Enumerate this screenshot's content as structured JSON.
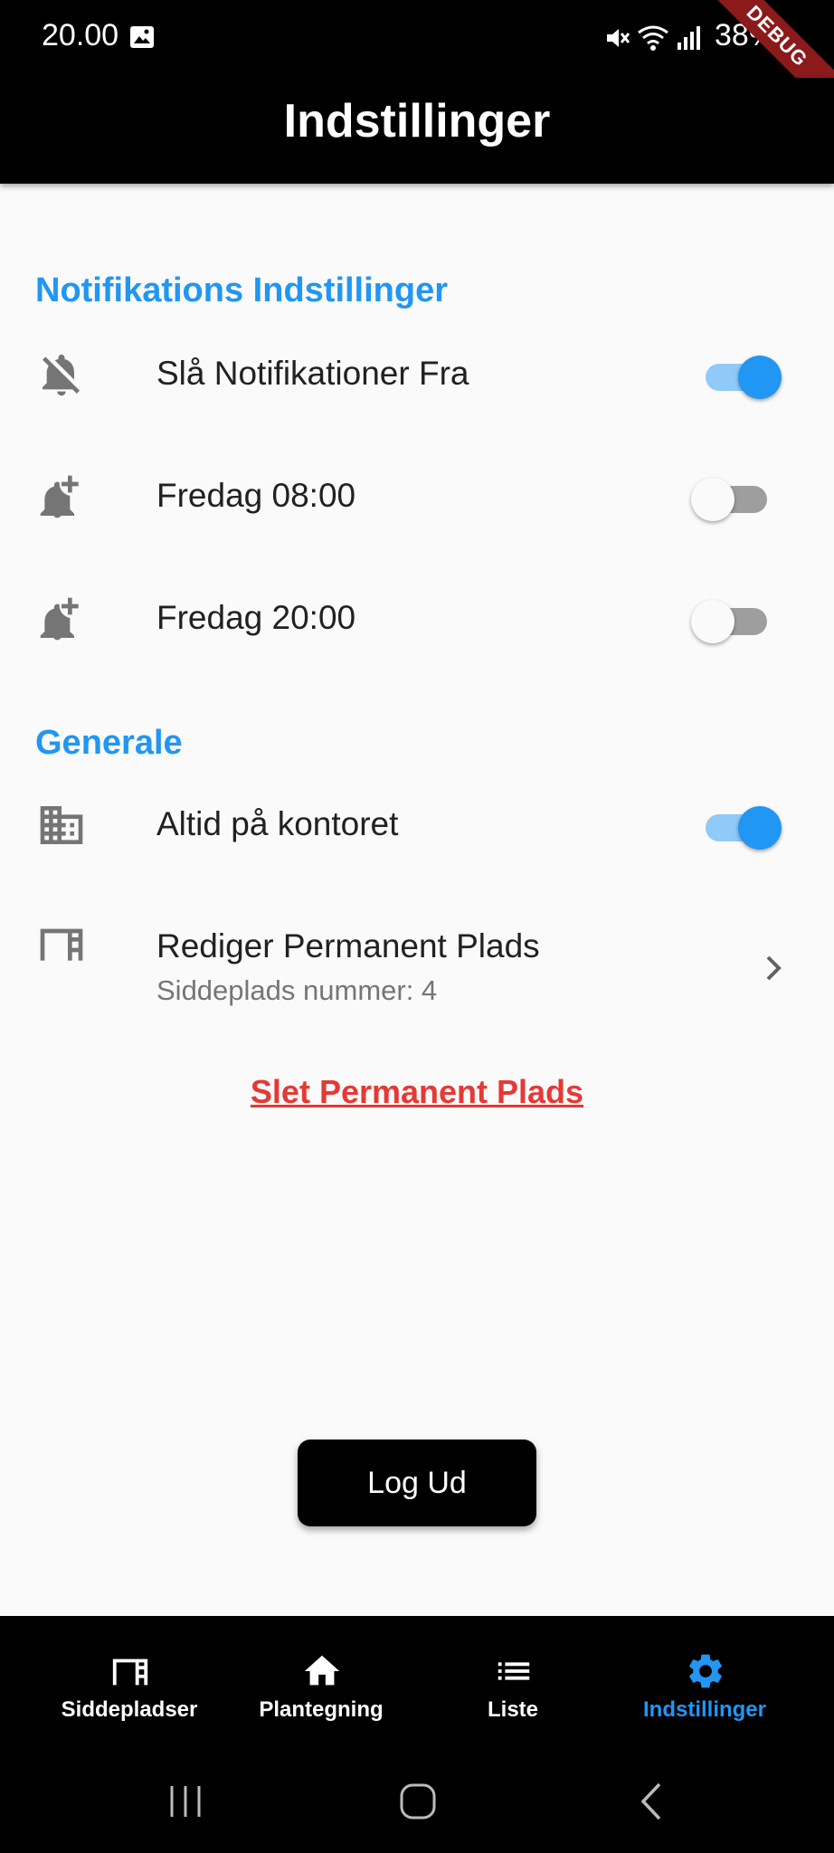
{
  "status_bar": {
    "time": "20.00",
    "battery": "38%",
    "icons": [
      "gallery-icon",
      "mute-icon",
      "wifi-icon",
      "signal-icon",
      "battery-icon"
    ]
  },
  "debug_banner": "DEBUG",
  "app_bar": {
    "title": "Indstillinger"
  },
  "notifications": {
    "title": "Notifikations Indstillinger",
    "items": [
      {
        "label": "Slå Notifikationer Fra",
        "icon": "bell-off-icon",
        "on": true
      },
      {
        "label": "Fredag 08:00",
        "icon": "bell-plus-icon",
        "on": false
      },
      {
        "label": "Fredag 20:00",
        "icon": "bell-plus-icon",
        "on": false
      }
    ]
  },
  "general": {
    "title": "Generale",
    "office": {
      "label": "Altid på kontoret",
      "icon": "building-icon",
      "on": true
    },
    "permanent_seat": {
      "label": "Rediger Permanent Plads",
      "subtitle": "Siddeplads nummer: 4",
      "icon": "desk-icon"
    }
  },
  "delete_link": "Slet Permanent Plads",
  "logout_label": "Log Ud",
  "colors": {
    "accent": "#2196f3",
    "danger": "#e53935",
    "bar": "#000000"
  },
  "bottom_nav": [
    {
      "label": "Siddepladser",
      "icon": "desk-icon",
      "active": false
    },
    {
      "label": "Plantegning",
      "icon": "home-icon",
      "active": false
    },
    {
      "label": "Liste",
      "icon": "list-icon",
      "active": false
    },
    {
      "label": "Indstillinger",
      "icon": "gear-icon",
      "active": true
    }
  ]
}
